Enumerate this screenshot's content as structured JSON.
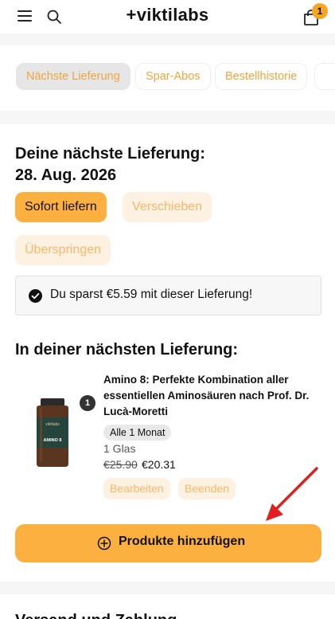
{
  "header": {
    "logo": "+viktilabs",
    "cart_count": "1"
  },
  "tabs": [
    {
      "label": "Nächste Lieferung"
    },
    {
      "label": "Spar-Abos"
    },
    {
      "label": "Bestellhistorie"
    }
  ],
  "delivery": {
    "heading_line1": "Deine nächste Lieferung:",
    "heading_line2": "28. Aug. 2026",
    "deliver_now": "Sofort liefern",
    "postpone": "Verschieben",
    "skip": "Überspringen",
    "savings_notice": "Du sparst €5.59 mit dieser Lieferung!"
  },
  "items": {
    "heading": "In deiner nächsten Lieferung:",
    "product": {
      "title": "Amino 8: Perfekte Kombination aller essentiellen Aminosäuren nach Prof. Dr. Lucà-Moretti",
      "quantity": "1",
      "frequency": "Alle 1 Monat",
      "unit": "1 Glas",
      "price_old": "€25.90",
      "price_new": "€20.31",
      "edit": "Bearbeiten",
      "end": "Beenden",
      "image_label": "AMINO 8",
      "image_brand": "viktilabs"
    },
    "add_button": "Produkte hinzufügen"
  },
  "next_section": {
    "title": "Versand und Zahlung"
  },
  "colors": {
    "accent": "#fcb040",
    "accent_soft": "#fdf1e2",
    "accent_text": "#f0a640",
    "annotation_arrow": "#e02020"
  }
}
